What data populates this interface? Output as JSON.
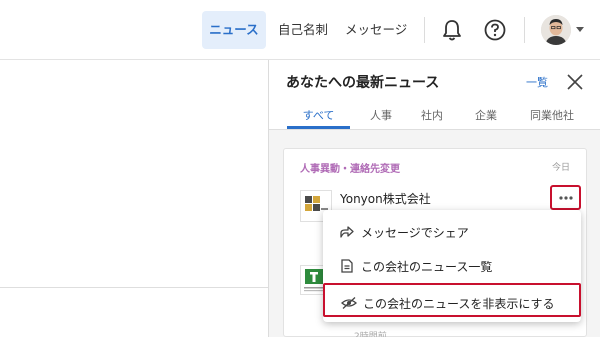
{
  "nav": {
    "news": "ニュース",
    "cards": "自己名刺",
    "messages": "メッセージ"
  },
  "panel": {
    "title": "あなたへの最新ニュース",
    "list_link": "一覧",
    "tabs": [
      "すべて",
      "人事",
      "社内",
      "企業",
      "同業他社"
    ]
  },
  "news_item": {
    "category": "人事異動・連絡先変更",
    "date": "今日",
    "company": "Yonyon株式会社",
    "time_ago": "2時間前"
  },
  "menu": {
    "items": [
      {
        "label": "メッセージでシェア",
        "icon": "share-icon"
      },
      {
        "label": "この会社のニュース一覧",
        "icon": "document-icon"
      },
      {
        "label": "この会社のニュースを非表示にする",
        "icon": "eye-off-icon"
      }
    ]
  },
  "colors": {
    "accent": "#2a6fc9",
    "highlight": "#c8102e",
    "category": "#b06bb6"
  }
}
